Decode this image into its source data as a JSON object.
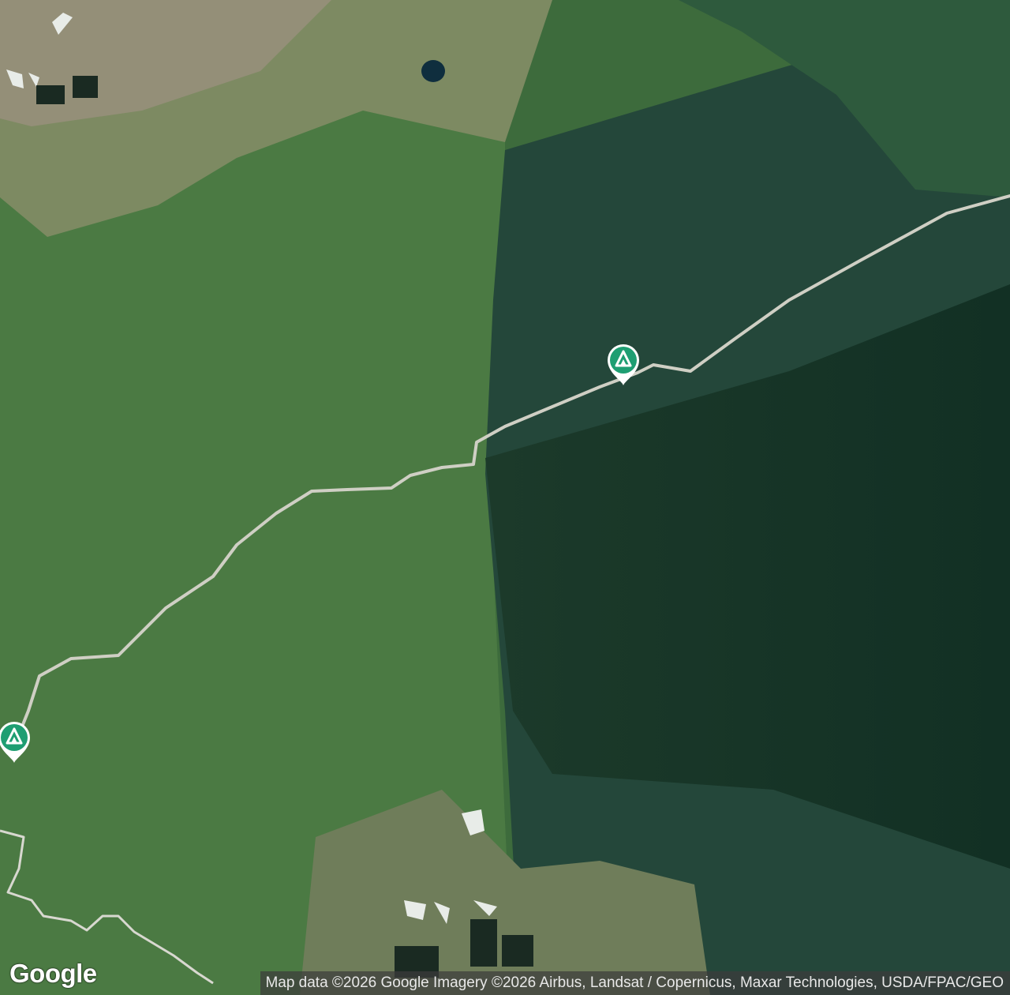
{
  "map": {
    "type": "satellite",
    "markers": [
      {
        "name": "campground-marker-1",
        "icon": "tent-icon",
        "color": "#1e9e72"
      },
      {
        "name": "campground-marker-2",
        "icon": "tent-icon",
        "color": "#1e9e72"
      }
    ],
    "road_color": "#cfcfc4",
    "trail_color": "#d8d8d0"
  },
  "branding": {
    "logo_text": "Google"
  },
  "attribution": {
    "text": "Map data ©2026 Google Imagery ©2026 Airbus, Landsat / Copernicus, Maxar Technologies, USDA/FPAC/GEO"
  }
}
